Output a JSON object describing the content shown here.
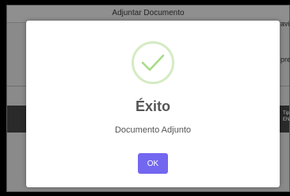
{
  "background_window": {
    "title": "Adjuntar Documento",
    "right_fragment_top": "avi",
    "right_fragment_mid": "pre",
    "right_fragment_dark_1": "Tip",
    "right_fragment_dark_2": "EN"
  },
  "dialog": {
    "icon": "success-check-icon",
    "title": "Éxito",
    "message": "Documento Adjunto",
    "ok_label": "OK"
  },
  "colors": {
    "accent": "#7367f0",
    "success_ring": "#d4ebc3",
    "success_check": "#a5dc86"
  }
}
